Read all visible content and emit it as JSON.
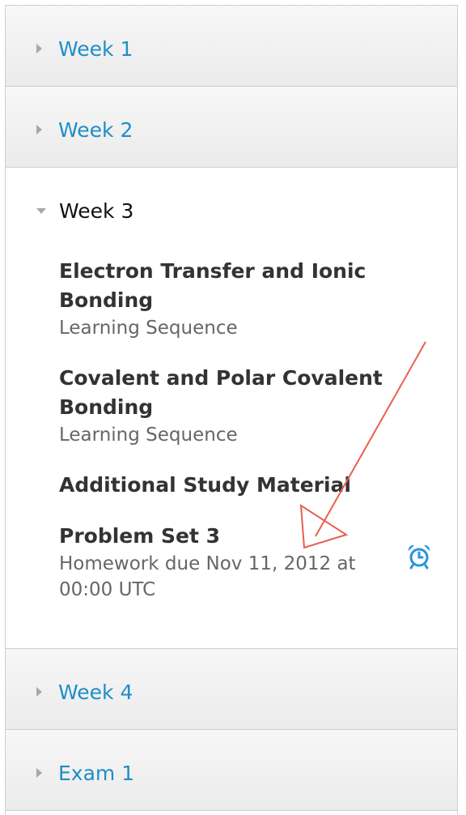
{
  "chapters": [
    {
      "label": "Week 1"
    },
    {
      "label": "Week 2"
    },
    {
      "label": "Week 3",
      "sections": [
        {
          "title": "Electron Transfer and Ionic Bonding",
          "subtitle": "Learning Sequence"
        },
        {
          "title": "Covalent and Polar Covalent Bonding",
          "subtitle": "Learning Sequence"
        },
        {
          "title": "Additional Study Material",
          "subtitle": ""
        },
        {
          "title": "Problem Set 3",
          "subtitle": "Homework due Nov 11, 2012 at 00:00 UTC"
        }
      ]
    },
    {
      "label": "Week 4"
    },
    {
      "label": "Exam 1"
    }
  ],
  "colors": {
    "link": "#1f8ec7",
    "alarm": "#2496dc",
    "annotation": "#e8604c"
  },
  "icons": {
    "alarm": "alarm-clock-icon",
    "collapsed": "triangle-right-icon",
    "expanded": "triangle-down-icon"
  }
}
